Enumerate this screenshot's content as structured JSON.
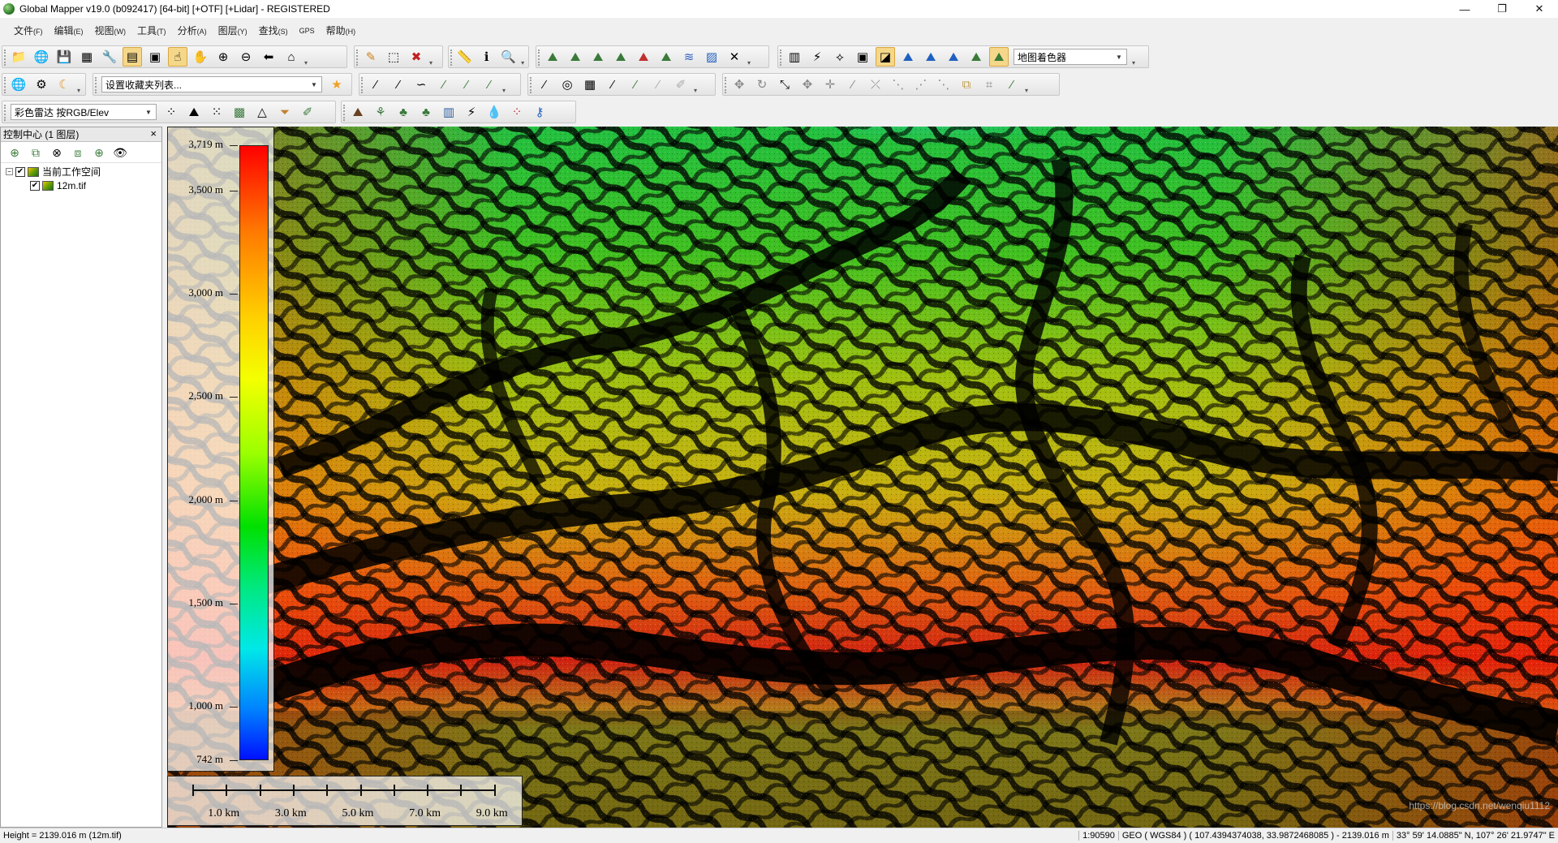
{
  "window": {
    "title": "Global Mapper v19.0 (b092417) [64-bit] [+OTF] [+Lidar] - REGISTERED",
    "controls": [
      "—",
      "❐",
      "✕"
    ]
  },
  "menu": [
    {
      "label": "文件",
      "key": "(F)"
    },
    {
      "label": "编辑",
      "key": "(E)"
    },
    {
      "label": "视图",
      "key": "(W)"
    },
    {
      "label": "工具",
      "key": "(T)"
    },
    {
      "label": "分析",
      "key": "(A)"
    },
    {
      "label": "图层",
      "key": "(Y)"
    },
    {
      "label": "查找",
      "key": "(S)"
    },
    {
      "label": "GPS",
      "key": ""
    },
    {
      "label": "帮助",
      "key": "(H)"
    }
  ],
  "toolbars": {
    "shader_select": "地图着色器",
    "favorites_select": "设置收藏夹列表...",
    "color_mode_select": "彩色雷达 按RGB/Elev"
  },
  "control_center": {
    "title": "控制中心 (1 图层)",
    "close": "×",
    "workspace_label": "当前工作空间",
    "layer_label": "12m.tif"
  },
  "legend": {
    "labels": [
      "3,719 m",
      "3,500 m",
      "3,000 m",
      "2,500 m",
      "2,000 m",
      "1,500 m",
      "1,000 m",
      "742 m"
    ],
    "values": [
      3719,
      3500,
      3000,
      2500,
      2000,
      1500,
      1000,
      742
    ],
    "min": 742,
    "max": 3719
  },
  "scalebar": {
    "labels": [
      "1.0 km",
      "3.0 km",
      "5.0 km",
      "7.0 km",
      "9.0 km"
    ]
  },
  "status": {
    "height": "Height = 2139.016 m (12m.tif)",
    "scale": "1:90590",
    "coords": "GEO ( WGS84 ) ( 107.4394374038, 33.9872468085 ) - 2139.016 m",
    "dms": "33° 59' 14.0885\" N, 107° 26' 21.9747\" E"
  },
  "watermark": "https://blog.csdn.net/wenqiu1112"
}
